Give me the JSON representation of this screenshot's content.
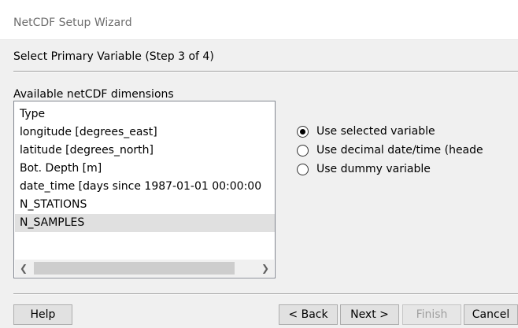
{
  "window": {
    "title": "NetCDF Setup Wizard"
  },
  "step": {
    "title": "Select Primary Variable (Step 3 of 4)"
  },
  "dimensions": {
    "label": "Available netCDF dimensions",
    "items": [
      "Type",
      "longitude [degrees_east]",
      "latitude [degrees_north]",
      "Bot. Depth [m]",
      "date_time [days since 1987-01-01 00:00:00",
      "N_STATIONS",
      "N_SAMPLES"
    ],
    "selected_item": "N_SAMPLES",
    "scroll_left_icon": "chevron-left-icon",
    "scroll_right_icon": "chevron-right-icon"
  },
  "options": {
    "items": [
      {
        "label": "Use selected variable",
        "checked": true
      },
      {
        "label": "Use decimal date/time (heade",
        "checked": false
      },
      {
        "label": "Use dummy variable",
        "checked": false
      }
    ]
  },
  "buttons": {
    "help": "Help",
    "back": "< Back",
    "next": "Next >",
    "finish": "Finish",
    "cancel": "Cancel"
  },
  "colors": {
    "dialog_background": "#f0f0f0",
    "selection_background": "#e0e0e0",
    "disabled_text": "#a0a0a0"
  }
}
